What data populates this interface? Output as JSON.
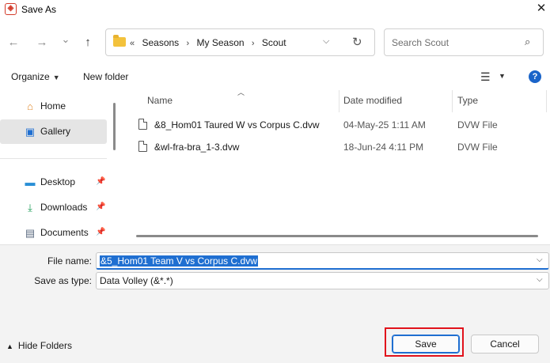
{
  "window": {
    "title": "Save As",
    "close_glyph": "✕"
  },
  "nav": {
    "back_glyph": "←",
    "forward_glyph": "→",
    "recent_glyph": "⌄",
    "up_glyph": "↑",
    "breadcrumbs": [
      "Seasons",
      "My Season",
      "Scout"
    ],
    "overflow_glyph": "«",
    "separator_glyph": "›",
    "search_placeholder": "Search Scout"
  },
  "toolbar": {
    "organize_label": "Organize",
    "new_folder_label": "New folder"
  },
  "sidebar": {
    "items": [
      {
        "label": "Home",
        "icon": "home-icon",
        "pinned": false,
        "selected": false
      },
      {
        "label": "Gallery",
        "icon": "gallery-icon",
        "pinned": false,
        "selected": true
      },
      {
        "label": "Desktop",
        "icon": "desktop-icon",
        "pinned": true,
        "selected": false
      },
      {
        "label": "Downloads",
        "icon": "downloads-icon",
        "pinned": true,
        "selected": false
      },
      {
        "label": "Documents",
        "icon": "documents-icon",
        "pinned": true,
        "selected": false
      }
    ]
  },
  "file_list": {
    "columns": {
      "name": "Name",
      "date": "Date modified",
      "type": "Type"
    },
    "rows": [
      {
        "name": "&8_Hom01 Taured W vs Corpus C.dvw",
        "date": "04-May-25 1:11 AM",
        "type": "DVW File"
      },
      {
        "name": "&wl-fra-bra_1-3.dvw",
        "date": "18-Jun-24 4:11 PM",
        "type": "DVW File"
      }
    ]
  },
  "form": {
    "file_name_label": "File name:",
    "file_name_value": "&5_Hom01 Team V vs Corpus C.dvw",
    "save_type_label": "Save as type:",
    "save_type_value": "Data Volley (&*.*)"
  },
  "footer": {
    "hide_folders_label": "Hide Folders",
    "save_label": "Save",
    "cancel_label": "Cancel"
  },
  "colors": {
    "accent": "#1f6fd1",
    "highlight": "#e1121b",
    "folder": "#f3c23c"
  }
}
